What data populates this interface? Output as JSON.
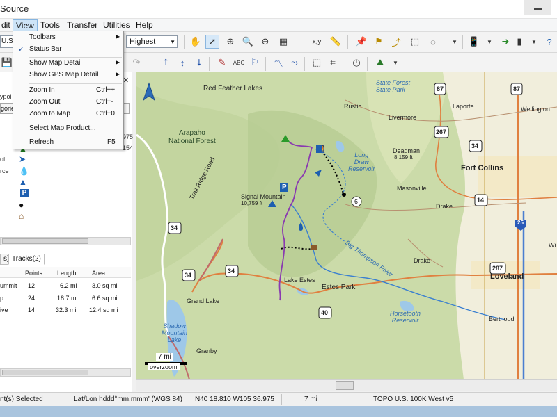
{
  "window": {
    "title": "Source"
  },
  "menubar": {
    "items": [
      "dit",
      "View",
      "Tools",
      "Transfer",
      "Utilities",
      "Help"
    ]
  },
  "toolbar": {
    "region_prefix": "U.S.",
    "detail_level": "Highest",
    "coord_button": "x,y",
    "icons": [
      "hand-icon",
      "pointer-icon",
      "zoom-in-icon",
      "zoom-out-icon",
      "map-grid-icon",
      "measure-icon",
      "ruler-icon",
      "waypoint-icon",
      "flag-icon",
      "route-icon",
      "select-region-icon",
      "lasso-icon",
      "gps-device-icon",
      "send-to-device-icon",
      "receive-icon",
      "help-icon"
    ]
  },
  "view_menu": {
    "items": [
      {
        "label": "Toolbars",
        "submenu": true
      },
      {
        "label": "Status Bar",
        "checked": true
      },
      {
        "label": "Show Map Detail",
        "submenu": true
      },
      {
        "label": "Show GPS Map Detail",
        "submenu": true
      },
      {
        "label": "Zoom In",
        "shortcut": "Ctrl++"
      },
      {
        "label": "Zoom Out",
        "shortcut": "Ctrl+-"
      },
      {
        "label": "Zoom to Map",
        "shortcut": "Ctrl+0"
      },
      {
        "label": "Select Map Product..."
      },
      {
        "label": "Refresh",
        "shortcut": "F5"
      }
    ]
  },
  "left_panel": {
    "tab_label": "Wa",
    "row_fragment": "ypoi",
    "categories_label": "gories",
    "side_numbers": [
      "975",
      "154"
    ],
    "waypoint_labels": [
      "ot",
      "rce"
    ],
    "bottom_tabs": [
      "s)",
      "Tracks(2)"
    ],
    "columns": [
      "Points",
      "Length",
      "Area"
    ],
    "rows": [
      {
        "name": "ummit",
        "points": "12",
        "length": "6.2 mi",
        "area": "3.0 sq mi"
      },
      {
        "name": "p",
        "points": "24",
        "length": "18.7 mi",
        "area": "6.6 sq mi"
      },
      {
        "name": "ive",
        "points": "14",
        "length": "32.3 mi",
        "area": "12.4 sq mi"
      }
    ]
  },
  "map": {
    "labels": {
      "red_feather_lakes": "Red Feather Lakes",
      "state_forest_sp": "State Forest\nState Park",
      "rustic": "Rustic",
      "livermore": "Livermore",
      "laporte": "Laporte",
      "wellington": "Wellington",
      "arapaho": "Arapaho\nNational Forest",
      "trail_ridge_road": "Trail Ridge Road",
      "long_draw": "Long\nDraw\nReservoir",
      "deadman": "Deadman",
      "deadman_elev": "8,159 ft",
      "fort_collins": "Fort Collins",
      "signal_mountain": "Signal Mountain",
      "signal_elev": "10,759 ft",
      "masonville": "Masonville",
      "drake_1": "Drake",
      "drake_2": "Drake",
      "big_thompson": "Big Thompson River",
      "lake_estes": "Lake Estes",
      "estes_park": "Estes Park",
      "loveland": "Loveland",
      "horsetooth": "Horsetooth\nReservoir",
      "berthoud": "Berthoud",
      "grand_lake": "Grand Lake",
      "shadow_mountain": "Shadow\nMountain\nLake",
      "granby": "Granby",
      "wi": "Wi"
    },
    "shields": [
      "87",
      "87",
      "267",
      "34",
      "14",
      "34",
      "34",
      "34",
      "40",
      "287",
      "6",
      "25"
    ],
    "scale": "7 mi",
    "overzoom": "overzoom"
  },
  "status": {
    "selected": "nt(s) Selected",
    "format": "Lat/Lon hddd°mm.mmm' (WGS 84)",
    "coords": "N40 18.810  W105 36.975",
    "scale": "7 mi",
    "product": "TOPO U.S. 100K West v5"
  }
}
